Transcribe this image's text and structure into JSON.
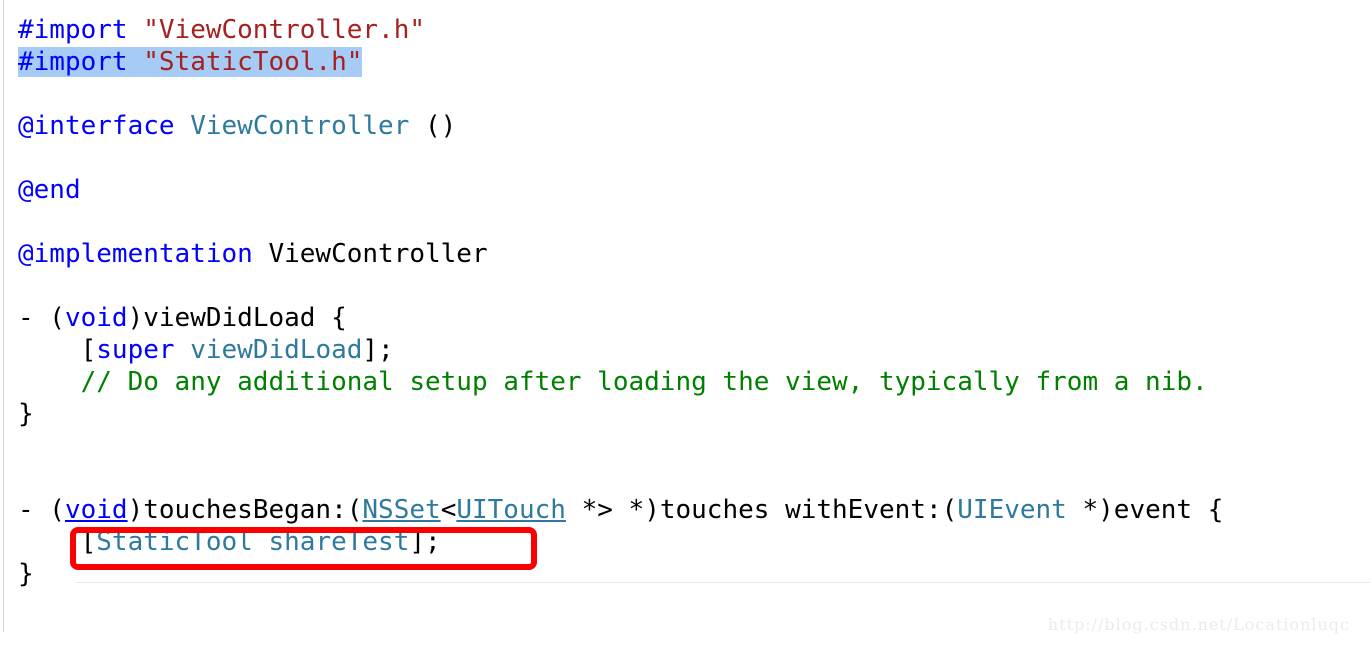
{
  "editor": {
    "language": "Objective-C",
    "background_color": "#ffffff",
    "font_size_px": 26,
    "line_height_px": 32,
    "selection_color": "#a6ccf5",
    "gutter_line_color": "#d4d4d4"
  },
  "syntax_colors": {
    "keyword": "#0000ff",
    "string": "#a52020",
    "comment": "#008000",
    "type_or_method": "#2d7a9e",
    "plain": "#000000"
  },
  "annotation": {
    "shape": "rounded-rectangle",
    "color": "#fa0000",
    "stroke_px": 6,
    "target_text": "[StaticTool shareTest];"
  },
  "watermark": {
    "text": "http://blog.csdn.net/Locationluqc",
    "color": "#ebebeb"
  },
  "code_lines": [
    {
      "id": 1,
      "selected": false,
      "tokens": [
        {
          "t": "#import",
          "c": "kw"
        },
        {
          "t": " ",
          "c": "plain"
        },
        {
          "t": "\"ViewController.h\"",
          "c": "str"
        }
      ]
    },
    {
      "id": 2,
      "selected": true,
      "tokens": [
        {
          "t": "#import",
          "c": "kw"
        },
        {
          "t": " ",
          "c": "plain"
        },
        {
          "t": "\"StaticTool.h\"",
          "c": "str"
        }
      ]
    },
    {
      "id": 3,
      "selected": false,
      "tokens": []
    },
    {
      "id": 4,
      "selected": false,
      "tokens": [
        {
          "t": "@interface",
          "c": "kw"
        },
        {
          "t": " ",
          "c": "plain"
        },
        {
          "t": "ViewController",
          "c": "type"
        },
        {
          "t": " ()",
          "c": "plain"
        }
      ]
    },
    {
      "id": 5,
      "selected": false,
      "tokens": []
    },
    {
      "id": 6,
      "selected": false,
      "tokens": [
        {
          "t": "@end",
          "c": "kw"
        }
      ]
    },
    {
      "id": 7,
      "selected": false,
      "tokens": []
    },
    {
      "id": 8,
      "selected": false,
      "tokens": [
        {
          "t": "@implementation",
          "c": "kw"
        },
        {
          "t": " ViewController",
          "c": "plain"
        }
      ]
    },
    {
      "id": 9,
      "selected": false,
      "tokens": []
    },
    {
      "id": 10,
      "selected": false,
      "tokens": [
        {
          "t": "- (",
          "c": "plain"
        },
        {
          "t": "void",
          "c": "kw"
        },
        {
          "t": ")viewDidLoad {",
          "c": "plain"
        }
      ]
    },
    {
      "id": 11,
      "selected": false,
      "tokens": [
        {
          "t": "    [",
          "c": "plain"
        },
        {
          "t": "super",
          "c": "kw"
        },
        {
          "t": " ",
          "c": "plain"
        },
        {
          "t": "viewDidLoad",
          "c": "type"
        },
        {
          "t": "];",
          "c": "plain"
        }
      ]
    },
    {
      "id": 12,
      "selected": false,
      "tokens": [
        {
          "t": "    ",
          "c": "plain"
        },
        {
          "t": "// Do any additional setup after loading the view, typically from a nib.",
          "c": "cmt"
        }
      ]
    },
    {
      "id": 13,
      "selected": false,
      "tokens": [
        {
          "t": "}",
          "c": "plain"
        }
      ]
    },
    {
      "id": 14,
      "selected": false,
      "tokens": []
    },
    {
      "id": 15,
      "selected": false,
      "tokens": []
    },
    {
      "id": 16,
      "selected": false,
      "tokens": [
        {
          "t": "- (",
          "c": "plain"
        },
        {
          "t": "void",
          "c": "kw ul"
        },
        {
          "t": ")touchesBegan:(",
          "c": "plain"
        },
        {
          "t": "NSSet",
          "c": "type ul"
        },
        {
          "t": "<",
          "c": "plain"
        },
        {
          "t": "UITouch",
          "c": "type ul"
        },
        {
          "t": " *> *)touches withEvent:(",
          "c": "plain"
        },
        {
          "t": "UIEvent",
          "c": "type"
        },
        {
          "t": " *)event {",
          "c": "plain"
        }
      ]
    },
    {
      "id": 17,
      "selected": false,
      "tokens": [
        {
          "t": "    [",
          "c": "plain"
        },
        {
          "t": "StaticTool",
          "c": "type"
        },
        {
          "t": " ",
          "c": "plain"
        },
        {
          "t": "shareTest",
          "c": "type"
        },
        {
          "t": "];",
          "c": "plain"
        }
      ]
    },
    {
      "id": 18,
      "selected": false,
      "tokens": [
        {
          "t": "}",
          "c": "plain"
        }
      ]
    }
  ]
}
